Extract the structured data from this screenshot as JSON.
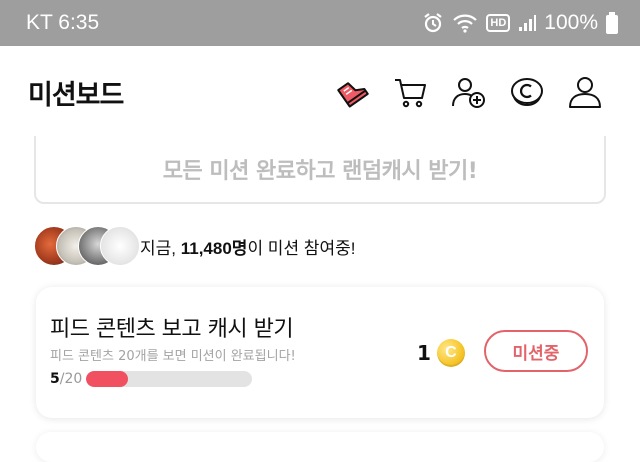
{
  "status_bar": {
    "carrier_time": "KT 6:35",
    "network_badge": "HD",
    "battery": "100%"
  },
  "header": {
    "title": "미션보드",
    "icons": [
      "shoe-icon",
      "cart-icon",
      "add-friend-icon",
      "cash-icon",
      "profile-icon"
    ]
  },
  "banner": {
    "text": "모든 미션 완료하고 랜덤캐시 받기!"
  },
  "participants": {
    "prefix": "지금, ",
    "count": "11,480명",
    "suffix": "이 미션 참여중!"
  },
  "mission": {
    "title": "피드 콘텐츠 보고 캐시 받기",
    "description": "피드 콘텐츠 20개를 보면 미션이 완료됩니다!",
    "progress_current": "5",
    "progress_total": "/20",
    "progress_fraction": 0.25,
    "reward": "1",
    "coin_symbol": "C",
    "button_label": "미션중"
  },
  "colors": {
    "accent": "#e2646a",
    "progress_fill": "#f05060",
    "status_bar": "#9e9e9e"
  }
}
